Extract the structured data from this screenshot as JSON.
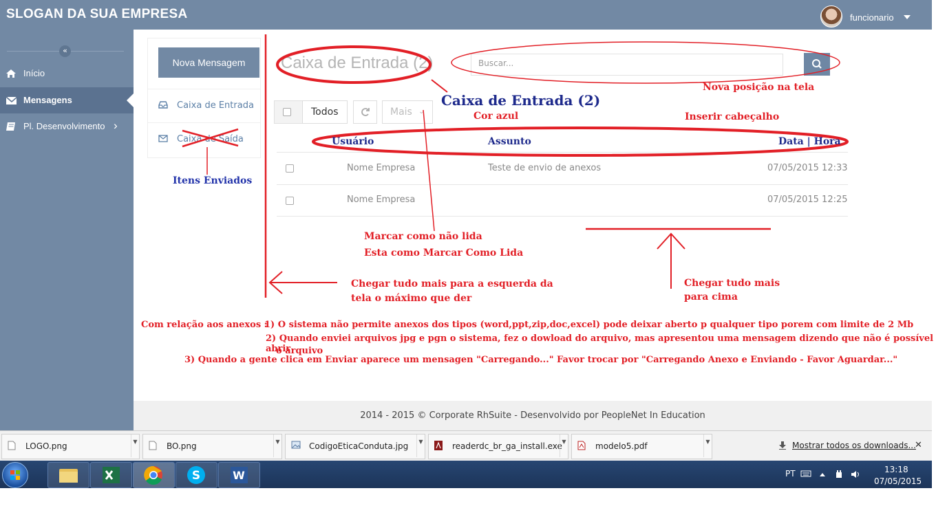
{
  "header": {
    "slogan": "SLOGAN DA SUA EMPRESA",
    "username": "funcionario"
  },
  "sidebar": {
    "collapse_glyph": "«",
    "items": [
      {
        "label": "Início",
        "icon": "home-icon"
      },
      {
        "label": "Mensagens",
        "icon": "envelope-icon"
      },
      {
        "label": "Pl. Desenvolvimento",
        "icon": "book-icon",
        "chevron": "›"
      }
    ]
  },
  "mail": {
    "new_button": "Nova Mensagem",
    "folders": [
      {
        "label": "Caixa de Entrada",
        "icon": "inbox-icon"
      },
      {
        "label": "Caixa de Saída",
        "icon": "envelope-icon"
      }
    ],
    "title": "Caixa de Entrada (2)",
    "search_placeholder": "Buscar...",
    "toolbar": {
      "select_all": "Todos",
      "more": "Mais"
    },
    "rows": [
      {
        "user": "Nome Empresa",
        "subject": "Teste de envio de anexos",
        "datetime": "07/05/2015 12:33"
      },
      {
        "user": "Nome Empresa",
        "subject": "",
        "datetime": "07/05/2015 12:25"
      }
    ]
  },
  "footer": {
    "text": "2014 - 2015 © Corporate RhSuite - Desenvolvido por PeopleNet In Education"
  },
  "annotations": {
    "new_title": "Caixa de Entrada (2)",
    "nova_posicao": "Nova posição na tela",
    "cor_azul": "Cor azul",
    "inserir_cabecalho": "Inserir cabeçalho",
    "col_usuario": "Usuário",
    "col_assunto": "Assunto",
    "col_data": "Data | Hora",
    "itens_enviados": "Itens Enviados",
    "marcar_nao_lida": "Marcar como não lida",
    "esta_como": "Esta como Marcar Como Lida",
    "chegar_esquerda_1": "Chegar tudo mais para a esquerda da",
    "chegar_esquerda_2": "tela    o máximo que der",
    "chegar_cima_1": "Chegar tudo mais",
    "chegar_cima_2": "para cima",
    "anexos_intro": "Com relação aos anexos :",
    "anexos_1": "1) O sistema não permite anexos dos tipos (word,ppt,zip,doc,excel) pode deixar aberto p qualquer tipo porem com limite de 2 Mb",
    "anexos_2a": "2) Quando enviei arquivos jpg e pgn o sistema, fez o dowload do arquivo, mas apresentou uma mensagem dizendo que não é possível abrir",
    "anexos_2b": "o arquivo",
    "anexos_3": "3) Quando a gente clica em Enviar aparece um mensagen \"Carregando...\"   Favor trocar por \"Carregando  Anexo   e Enviando - Favor Aguardar...\""
  },
  "downloads": {
    "items": [
      {
        "name": "LOGO.png",
        "icon": "file-icon"
      },
      {
        "name": "BO.png",
        "icon": "file-icon"
      },
      {
        "name": "CodigoEticaConduta.jpg",
        "icon": "image-file-icon"
      },
      {
        "name": "readerdc_br_ga_install.exe",
        "icon": "acrobat-icon"
      },
      {
        "name": "modelo5.pdf",
        "icon": "pdf-icon"
      }
    ],
    "show_all": "Mostrar todos os downloads...",
    "close": "✕"
  },
  "taskbar": {
    "apps": [
      "explorer-icon",
      "excel-icon",
      "chrome-icon",
      "skype-icon",
      "word-icon"
    ],
    "lang": "PT",
    "time": "13:18",
    "date": "07/05/2015"
  },
  "colors": {
    "brand": "#7289a4",
    "brand_dark": "#5b7290",
    "annotation_red": "#e21f26",
    "annotation_navy": "#1e2a8c"
  }
}
